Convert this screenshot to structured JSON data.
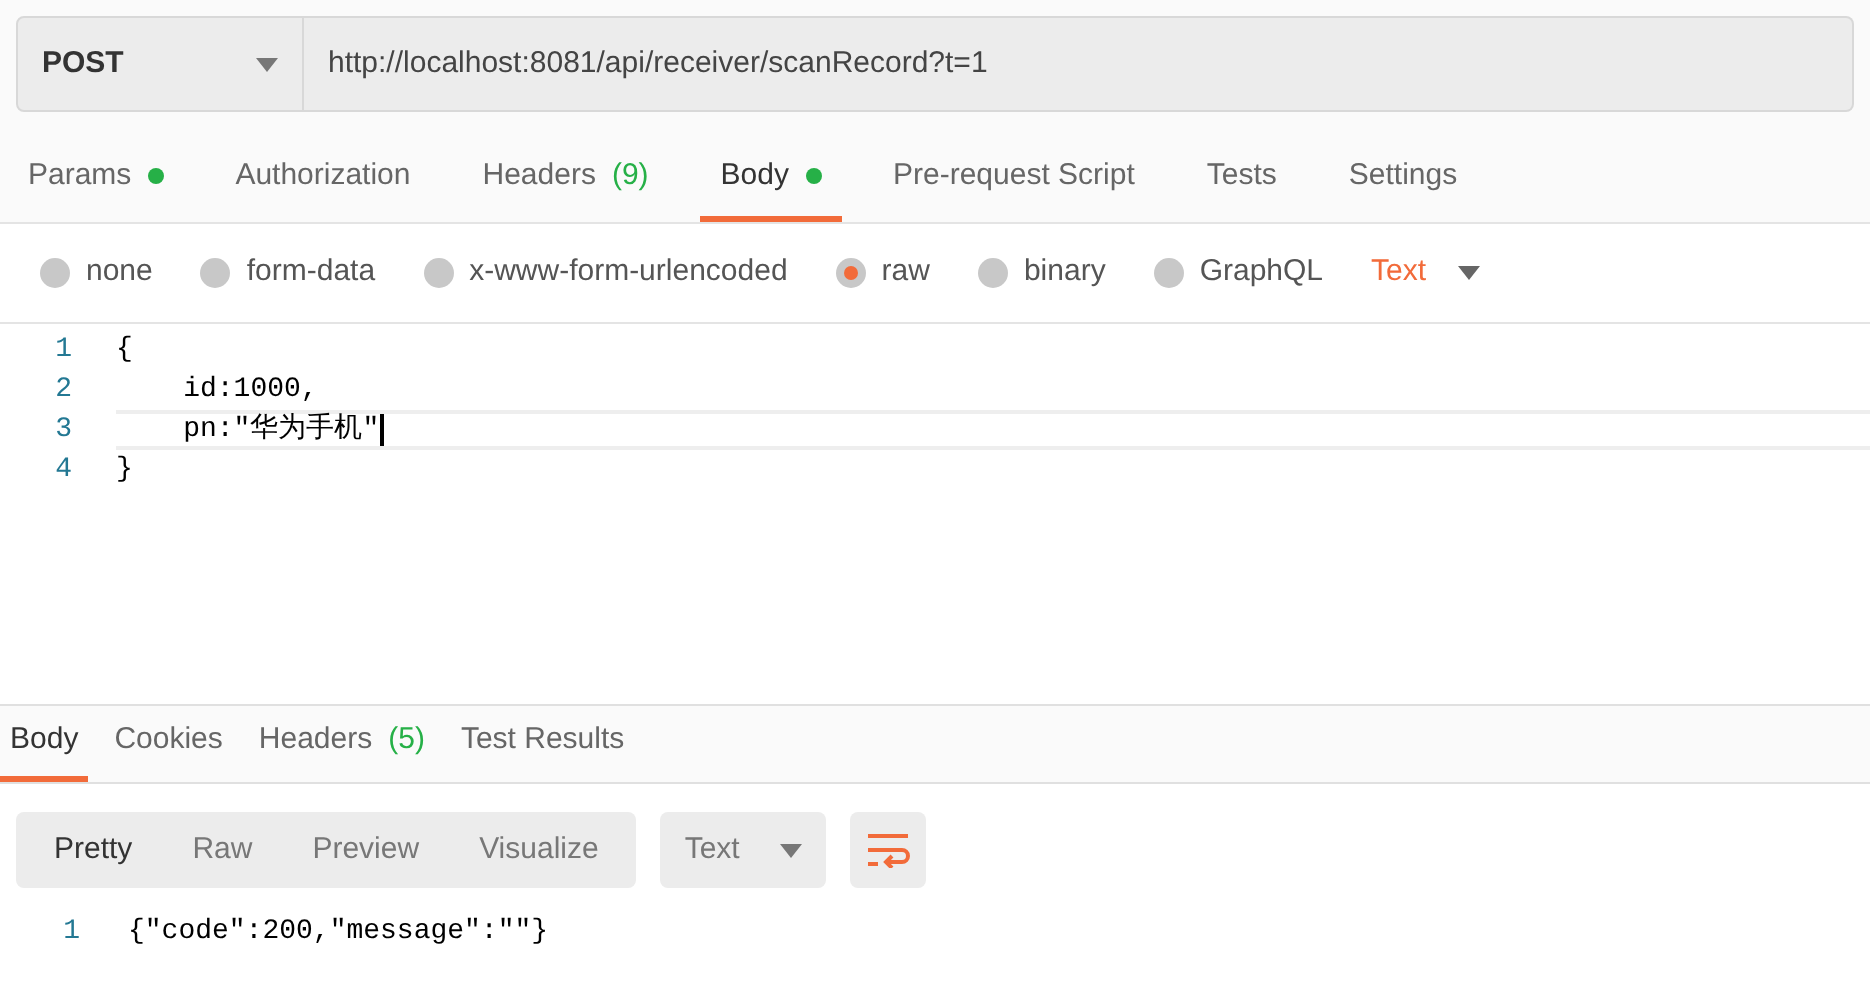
{
  "request": {
    "method": "POST",
    "url": "http://localhost:8081/api/receiver/scanRecord?t=1"
  },
  "request_tabs": [
    {
      "label": "Params",
      "dot": true,
      "selected": false
    },
    {
      "label": "Authorization",
      "dot": false,
      "selected": false
    },
    {
      "label": "Headers",
      "count": "(9)",
      "dot": false,
      "selected": false
    },
    {
      "label": "Body",
      "dot": true,
      "selected": true
    },
    {
      "label": "Pre-request Script",
      "dot": false,
      "selected": false
    },
    {
      "label": "Tests",
      "dot": false,
      "selected": false
    },
    {
      "label": "Settings",
      "dot": false,
      "selected": false
    }
  ],
  "body_types": [
    {
      "label": "none",
      "selected": false
    },
    {
      "label": "form-data",
      "selected": false
    },
    {
      "label": "x-www-form-urlencoded",
      "selected": false
    },
    {
      "label": "raw",
      "selected": true
    },
    {
      "label": "binary",
      "selected": false
    },
    {
      "label": "GraphQL",
      "selected": false
    }
  ],
  "language": "Text",
  "editor_lines": [
    {
      "number": "1",
      "code": "{",
      "active": false
    },
    {
      "number": "2",
      "code": "    id:1000,",
      "active": false
    },
    {
      "number": "3",
      "code": "    pn:\"华为手机\"",
      "active": true
    },
    {
      "number": "4",
      "code": "}",
      "active": false
    }
  ],
  "response_tabs": [
    {
      "label": "Body",
      "selected": true
    },
    {
      "label": "Cookies",
      "selected": false
    },
    {
      "label": "Headers",
      "count": "(5)",
      "selected": false
    },
    {
      "label": "Test Results",
      "selected": false
    }
  ],
  "view_modes": [
    {
      "label": "Pretty",
      "selected": true
    },
    {
      "label": "Raw",
      "selected": false
    },
    {
      "label": "Preview",
      "selected": false
    },
    {
      "label": "Visualize",
      "selected": false
    }
  ],
  "response_format": "Text",
  "response_lines": [
    {
      "number": "1",
      "code": "{\"code\":200,\"message\":\"\"}"
    }
  ]
}
